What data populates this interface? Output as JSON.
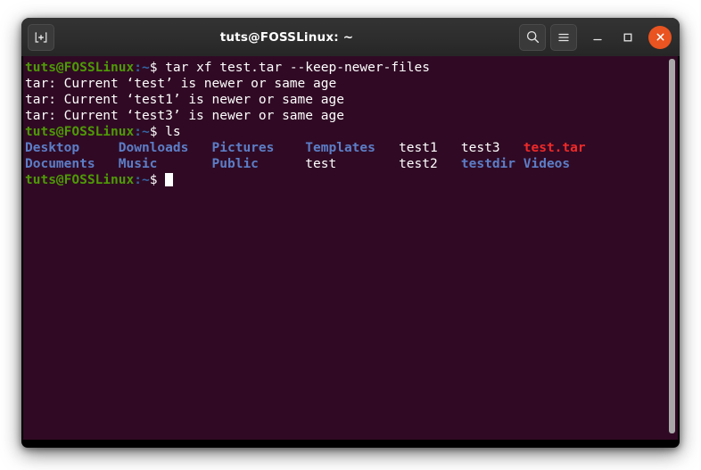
{
  "window": {
    "title": "tuts@FOSSLinux: ~",
    "colors": {
      "terminal_background": "#300a24",
      "titlebar_background": "#2d2d2d",
      "close_button": "#e95420",
      "prompt_green": "#4e9a06",
      "prompt_blue": "#3465a4",
      "directory_blue": "#5c7ec7",
      "archive_red": "#ef2929",
      "text_white": "#ffffff",
      "scrollbar_thumb": "#a8a8a8"
    }
  },
  "titlebar": {
    "new_tab_label": "+",
    "search_label": "",
    "menu_label": "",
    "minimize_label": "",
    "maximize_label": "",
    "close_label": ""
  },
  "terminal": {
    "prompt": {
      "user_host": "tuts@FOSSLinux",
      "path": ":~",
      "symbol": "$"
    },
    "lines": [
      {
        "type": "prompt",
        "command": "tar xf test.tar --keep-newer-files"
      },
      {
        "type": "output",
        "text": "tar: Current ‘test’ is newer or same age"
      },
      {
        "type": "output",
        "text": "tar: Current ‘test1’ is newer or same age"
      },
      {
        "type": "output",
        "text": "tar: Current ‘test3’ is newer or same age"
      },
      {
        "type": "prompt",
        "command": "ls"
      },
      {
        "type": "ls_row",
        "cells": [
          {
            "name": "Desktop",
            "kind": "directory"
          },
          {
            "name": "Downloads",
            "kind": "directory"
          },
          {
            "name": "Pictures",
            "kind": "directory"
          },
          {
            "name": "Templates",
            "kind": "directory"
          },
          {
            "name": "test1",
            "kind": "file"
          },
          {
            "name": "test3",
            "kind": "file"
          },
          {
            "name": "test.tar",
            "kind": "archive"
          }
        ]
      },
      {
        "type": "ls_row",
        "cells": [
          {
            "name": "Documents",
            "kind": "directory"
          },
          {
            "name": "Music",
            "kind": "directory"
          },
          {
            "name": "Public",
            "kind": "directory"
          },
          {
            "name": "test",
            "kind": "file"
          },
          {
            "name": "test2",
            "kind": "file"
          },
          {
            "name": "testdir",
            "kind": "directory"
          },
          {
            "name": "Videos",
            "kind": "directory"
          }
        ]
      },
      {
        "type": "prompt_cursor",
        "command": ""
      }
    ],
    "ls_column_widths": [
      12,
      12,
      12,
      12,
      8,
      8,
      9
    ]
  }
}
